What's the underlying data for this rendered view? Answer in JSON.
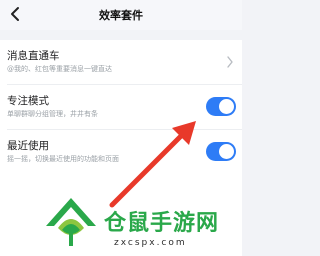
{
  "header": {
    "title": "效率套件"
  },
  "settings": {
    "items": [
      {
        "name": "消息直通车",
        "desc": "@我的、红包等重要消息一键直达"
      },
      {
        "name": "专注模式",
        "desc": "单聊群聊分组管理，井井有条",
        "toggle_on": true
      },
      {
        "name": "最近使用",
        "desc": "摇一摇，切换最近使用的功能和页面",
        "toggle_on": true
      }
    ]
  },
  "watermark": {
    "brand": "仓鼠手游网",
    "url": "zxcspx.com"
  },
  "colors": {
    "accent": "#2e7cf6",
    "arrow": "#e8392a",
    "brand_green": "#2aa84a"
  },
  "icons": {
    "back": "chevron-left-icon",
    "row_open": "chevron-right-icon",
    "logo": "leaf-house-logo"
  }
}
